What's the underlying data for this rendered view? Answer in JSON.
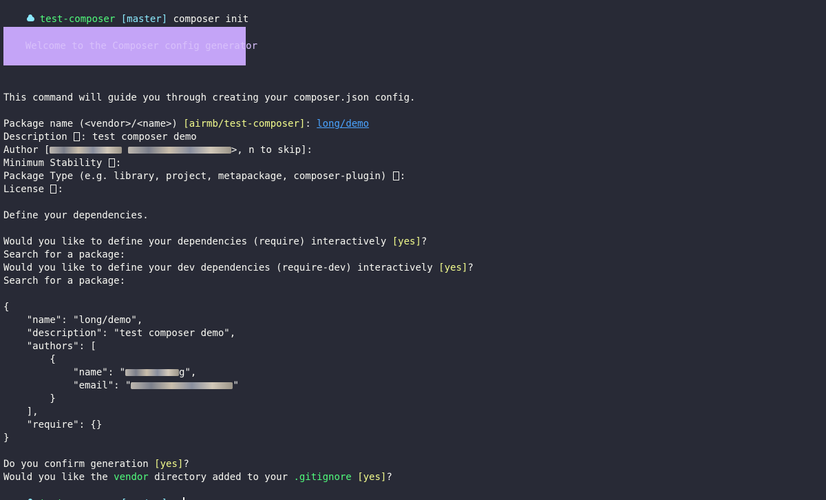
{
  "prompt": {
    "directory": "test-composer",
    "branch": "[master]",
    "command": "composer init",
    "bolt": "⚡"
  },
  "banner": "  Welcome to the Composer config generator  ",
  "intro": "This command will guide you through creating your composer.json config.",
  "questions": {
    "package_name_label": "Package name (<vendor>/<name>) ",
    "package_name_default": "[airmb/test-composer]",
    "package_name_answer": "long/demo",
    "description_label": "Description ",
    "description_answer": "test composer demo",
    "author_label": "Author [",
    "author_suffix": ">, n to skip]:",
    "min_stability_label": "Minimum Stability ",
    "package_type_label": "Package Type (e.g. library, project, metapackage, composer-plugin) ",
    "license_label": "License "
  },
  "define_deps": "Define your dependencies.",
  "deps": {
    "require_q": "Would you like to define your dependencies (require) interactively ",
    "require_dev_q": "Would you like to define your dev dependencies (require-dev) interactively ",
    "search": "Search for a package:",
    "default_yes": "[yes]"
  },
  "json_preview": {
    "open_brace": "{",
    "name_line": "    \"name\": \"long/demo\",",
    "description_line": "    \"description\": \"test composer demo\",",
    "authors_line": "    \"authors\": [",
    "inner_open": "        {",
    "author_name_prefix": "            \"name\": \"",
    "author_name_suffix": "g\",",
    "author_email_prefix": "            \"email\": \"",
    "author_email_suffix": "\"",
    "inner_close": "        }",
    "authors_close": "    ],",
    "require_line": "    \"require\": {}",
    "close_brace": "}"
  },
  "confirm": {
    "generation_q": "Do you confirm generation ",
    "gitignore_prefix": "Would you like the ",
    "vendor": "vendor",
    "gitignore_middle": " directory added to your ",
    "gitignore_file": ".gitignore",
    "question_mark": "?"
  },
  "colors": {
    "background": "#282a36",
    "foreground": "#f8f8f2",
    "cyan": "#8be9fd",
    "green": "#50fa7b",
    "yellow": "#f1fa8c",
    "banner": "#c4a4f7"
  }
}
